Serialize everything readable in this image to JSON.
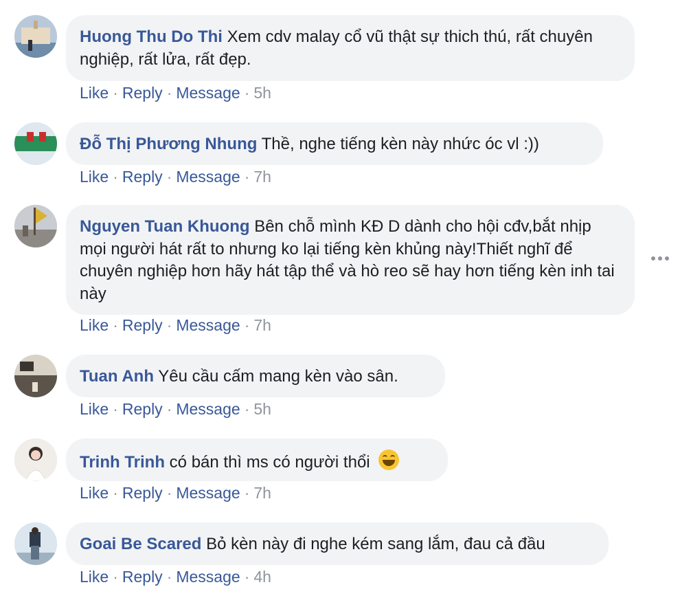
{
  "comments": [
    {
      "author": "Huong Thu Do Thi",
      "text": "Xem cdv malay cổ vũ thật sự thich thú, rất chuyên nghiệp, rất lửa, rất đẹp.",
      "actions": {
        "like": "Like",
        "reply": "Reply",
        "message": "Message"
      },
      "time": "5h"
    },
    {
      "author": "Đỗ Thị Phương Nhung",
      "text": "Thề, nghe tiếng kèn này nhức óc vl :))",
      "actions": {
        "like": "Like",
        "reply": "Reply",
        "message": "Message"
      },
      "time": "7h"
    },
    {
      "author": "Nguyen Tuan Khuong",
      "text": "Bên chỗ mình KĐ D dành cho hội cđv,bắt nhịp mọi người hát rất to nhưng ko lại tiếng kèn khủng này!Thiết nghĩ để chuyên nghiệp hơn hãy hát tập thể và hò reo sẽ hay hơn tiếng kèn inh tai này",
      "actions": {
        "like": "Like",
        "reply": "Reply",
        "message": "Message"
      },
      "time": "7h"
    },
    {
      "author": "Tuan Anh",
      "text": "Yêu cầu cấm mang kèn vào sân.",
      "actions": {
        "like": "Like",
        "reply": "Reply",
        "message": "Message"
      },
      "time": "5h"
    },
    {
      "author": "Trinh Trinh",
      "text": "có bán thì ms có người thổi",
      "emoji": "grinning-face-emoji",
      "actions": {
        "like": "Like",
        "reply": "Reply",
        "message": "Message"
      },
      "time": "7h"
    },
    {
      "author": "Goai Be Scared",
      "text": "Bỏ kèn này đi nghe kém sang lắm, đau cả đầu",
      "actions": {
        "like": "Like",
        "reply": "Reply",
        "message": "Message"
      },
      "time": "4h"
    }
  ],
  "separator": "·",
  "more_icon": "more-options-icon",
  "colors": {
    "author": "#385898",
    "bubble": "#f2f3f5",
    "meta": "#90949c"
  }
}
